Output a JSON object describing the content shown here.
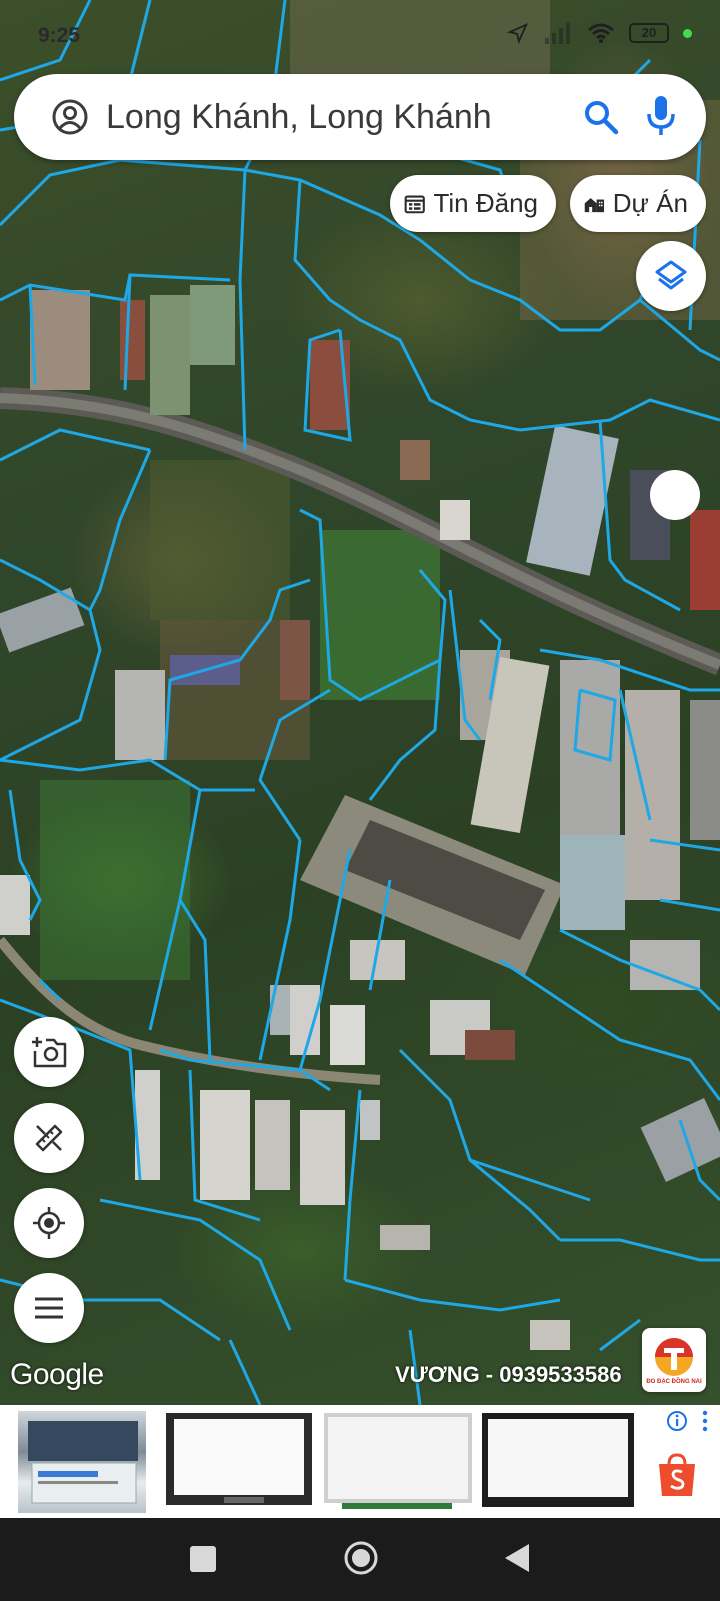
{
  "status_bar": {
    "time": "9:25",
    "battery": "20"
  },
  "search": {
    "query": "Long Khánh, Long Khánh"
  },
  "chips": {
    "listings_label": "Tin Đăng",
    "projects_label": "Dự Án"
  },
  "map": {
    "attribution": "Google",
    "watermark": "VƯƠNG - 0939533586",
    "brand_caption": "ĐO ĐẠC ĐỒNG NAI",
    "parcel_line_color": "#1fa8e6"
  },
  "icons": {
    "account": "account-circle-icon",
    "search": "search-icon",
    "mic": "mic-icon",
    "listings": "calendar-list-icon",
    "projects": "buildings-icon",
    "layers": "layers-icon",
    "camera": "add-camera-icon",
    "measure": "ruler-pencil-icon",
    "locate": "my-location-icon",
    "menu": "menu-icon",
    "ad_info": "info-icon",
    "ad_more": "more-vert-icon",
    "shop": "shopee-bag-icon"
  },
  "colors": {
    "accent_blue": "#1a73e8",
    "parcel_blue": "#1fa8e6",
    "nav_bar": "#1b1b1b"
  }
}
